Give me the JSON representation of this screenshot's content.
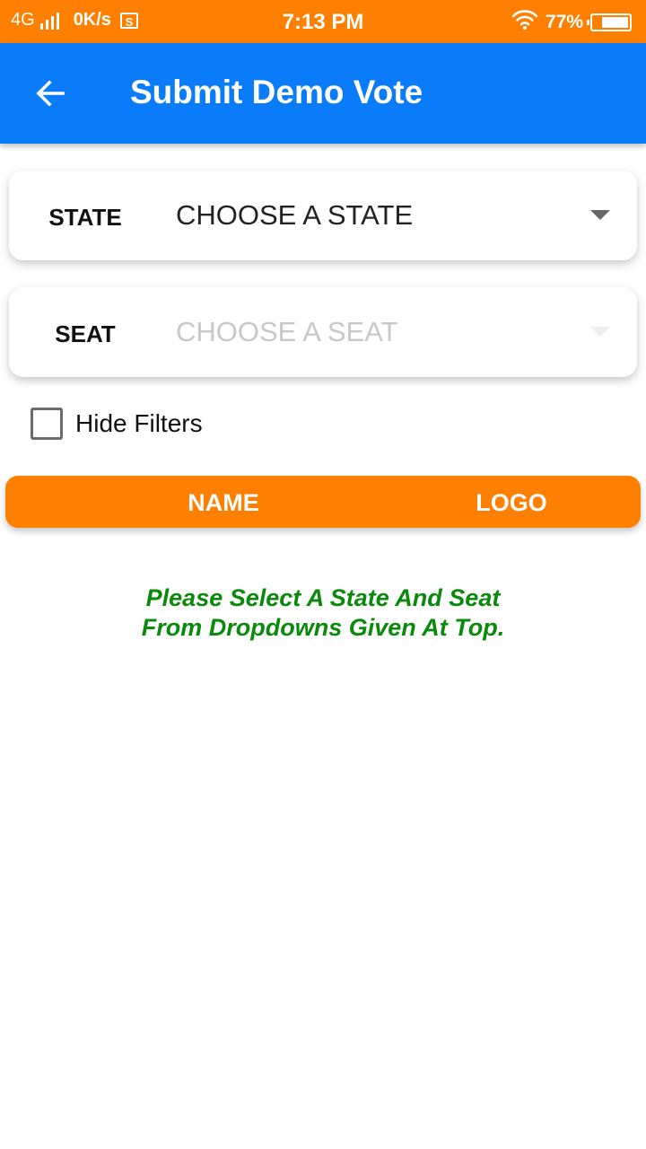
{
  "status_bar": {
    "network": "4G",
    "speed": "0K/s",
    "screenshot_icon_letter": "S",
    "time": "7:13 PM",
    "battery_percent": "77%",
    "battery_level": 0.77
  },
  "app_bar": {
    "title": "Submit Demo Vote",
    "back_icon": "arrow-left-icon",
    "background_color": "#0a7cfa"
  },
  "filters": {
    "state": {
      "label": "STATE",
      "value": "CHOOSE A STATE"
    },
    "seat": {
      "label": "SEAT",
      "value": "CHOOSE A SEAT"
    },
    "hide_filters": {
      "label": "Hide Filters",
      "checked": false
    }
  },
  "table_header": {
    "name": "NAME",
    "logo": "LOGO",
    "background_color": "#ff7f00"
  },
  "message": {
    "line1": "Please Select A State And Seat",
    "line2": "From Dropdowns Given At Top.",
    "color": "#0a8a0a"
  }
}
